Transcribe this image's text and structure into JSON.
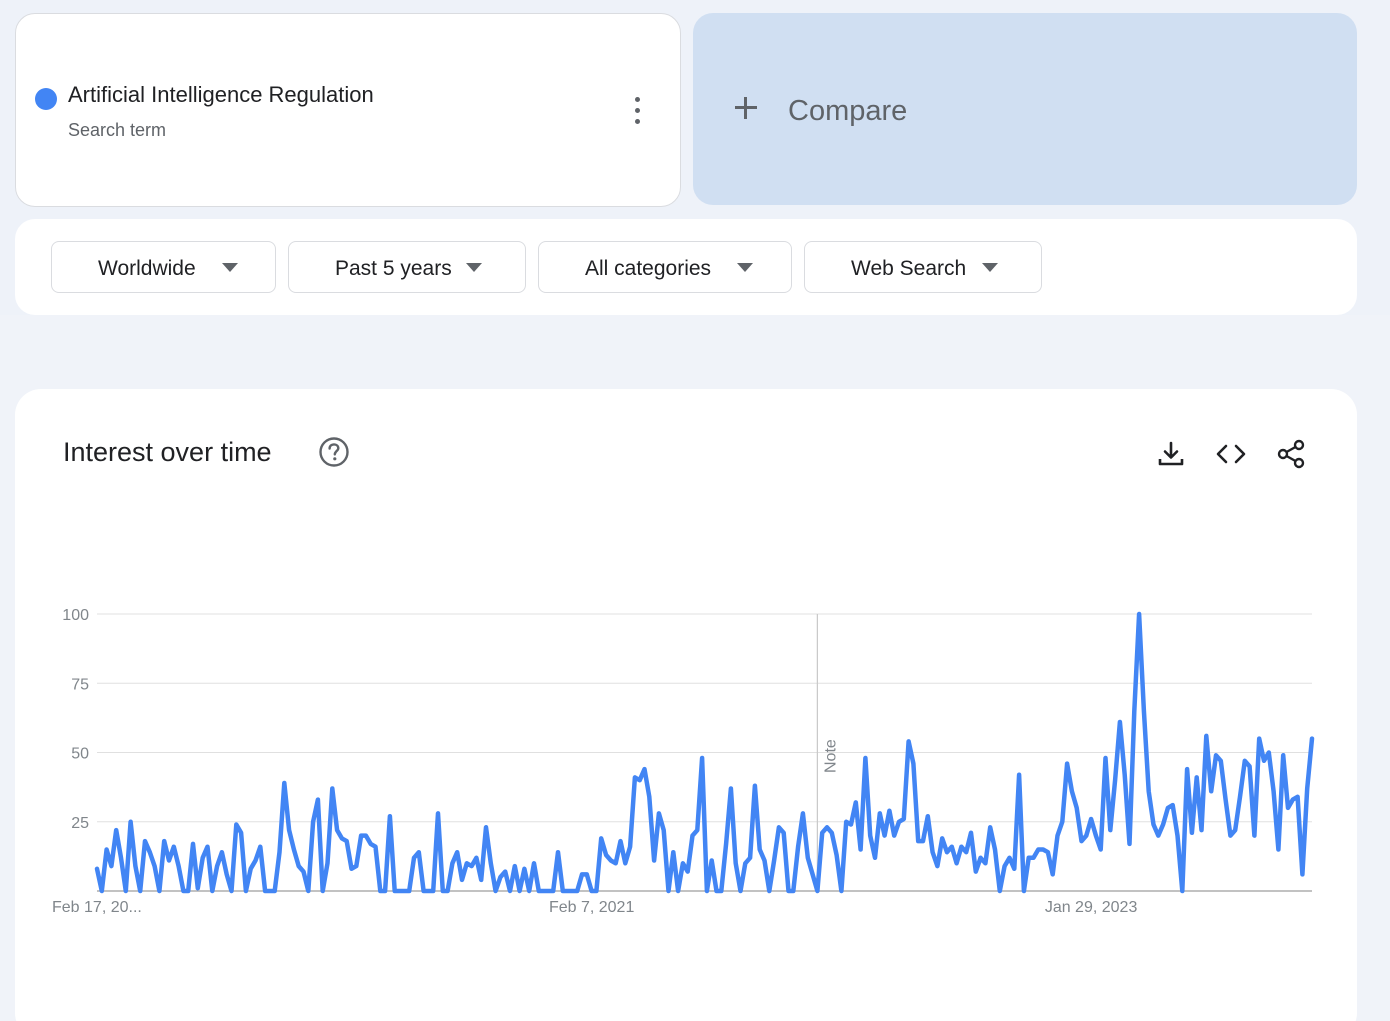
{
  "search_term": {
    "name": "Artificial Intelligence Regulation",
    "subtitle": "Search term",
    "color": "#4285f4"
  },
  "compare": {
    "label": "Compare"
  },
  "filters": {
    "region": "Worldwide",
    "time_range": "Past 5 years",
    "category": "All categories",
    "search_type": "Web Search"
  },
  "interest_panel": {
    "title": "Interest over time",
    "icons": [
      "help-icon",
      "download-icon",
      "embed-code-icon",
      "share-icon"
    ],
    "note_label": "Note"
  },
  "chart_data": {
    "type": "line",
    "ylim": [
      0,
      100
    ],
    "yticks": [
      100,
      75,
      50,
      25
    ],
    "xtick_labels": [
      "Feb 17, 20...",
      "Feb 7, 2021",
      "Jan 29, 2023"
    ],
    "xtick_week_index": [
      0,
      103,
      207
    ],
    "note_week_index": 150,
    "partial_data_from_index": 260,
    "grid": true,
    "legend": "none",
    "series": [
      {
        "color": "#4285f4",
        "values": [
          8,
          0,
          15,
          9,
          22,
          12,
          0,
          25,
          9,
          0,
          18,
          14,
          9,
          0,
          18,
          11,
          16,
          9,
          0,
          0,
          17,
          1,
          12,
          16,
          0,
          9,
          14,
          6,
          0,
          24,
          21,
          0,
          8,
          11,
          16,
          0,
          0,
          0,
          14,
          39,
          22,
          15,
          9,
          7,
          0,
          25,
          33,
          0,
          10,
          37,
          22,
          19,
          18,
          8,
          9,
          20,
          20,
          17,
          16,
          0,
          0,
          27,
          0,
          0,
          0,
          0,
          12,
          14,
          0,
          0,
          0,
          28,
          0,
          0,
          10,
          14,
          4,
          10,
          9,
          12,
          4,
          23,
          10,
          0,
          5,
          7,
          0,
          9,
          0,
          8,
          0,
          10,
          0,
          0,
          0,
          0,
          14,
          0,
          0,
          0,
          0,
          6,
          6,
          0,
          0,
          19,
          13,
          11,
          10,
          18,
          10,
          16,
          41,
          40,
          44,
          34,
          11,
          28,
          22,
          0,
          14,
          0,
          10,
          7,
          20,
          22,
          48,
          0,
          11,
          0,
          0,
          17,
          37,
          10,
          0,
          10,
          12,
          38,
          15,
          11,
          0,
          11,
          23,
          21,
          0,
          0,
          16,
          28,
          12,
          6,
          0,
          21,
          23,
          21,
          13,
          0,
          25,
          24,
          32,
          15,
          48,
          20,
          12,
          28,
          20,
          29,
          20,
          25,
          26,
          54,
          46,
          18,
          18,
          27,
          14,
          9,
          19,
          14,
          16,
          10,
          16,
          14,
          21,
          7,
          12,
          10,
          23,
          15,
          0,
          9,
          12,
          8,
          42,
          0,
          12,
          12,
          15,
          15,
          14,
          6,
          20,
          25,
          46,
          36,
          30,
          18,
          20,
          26,
          20,
          15,
          48,
          22,
          40,
          61,
          42,
          17,
          65,
          100,
          65,
          36,
          24,
          20,
          24,
          30,
          31,
          20,
          0,
          44,
          21,
          41,
          22,
          56,
          36,
          49,
          47,
          33,
          20,
          22,
          34,
          47,
          45,
          20,
          55,
          47,
          50,
          36,
          15,
          49,
          30,
          33,
          34,
          6,
          37,
          55
        ]
      }
    ]
  }
}
